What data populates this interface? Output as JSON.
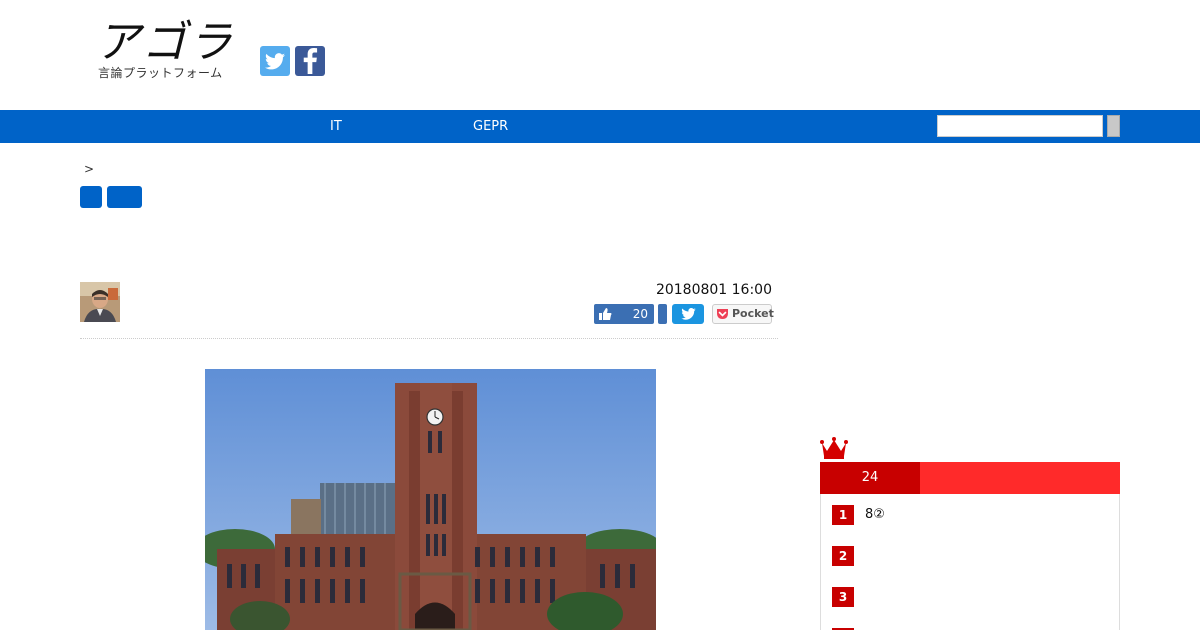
{
  "header": {
    "logo_main": "アゴラ",
    "logo_sub": "言論プラットフォーム",
    "social": [
      {
        "name": "twitter-icon",
        "color": "#55acee"
      },
      {
        "name": "facebook-icon",
        "color": "#3b5998"
      }
    ]
  },
  "nav": {
    "items": [
      {
        "label": "IT"
      },
      {
        "label": "GEPR"
      }
    ],
    "search_value": "",
    "accent_color": "#0063c8"
  },
  "breadcrumb": {
    "separator": ">"
  },
  "article": {
    "date": "20180801 16:00",
    "share": {
      "like_count": "20",
      "pocket_label": "Pocket"
    }
  },
  "ranking": {
    "tab_label": "24",
    "items": [
      {
        "rank": "1",
        "title": "8②"
      },
      {
        "rank": "2",
        "title": ""
      },
      {
        "rank": "3",
        "title": ""
      }
    ],
    "accent_color": "#c80000"
  }
}
